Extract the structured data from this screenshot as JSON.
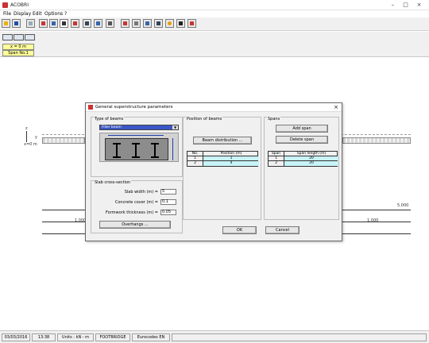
{
  "app": {
    "title": "ACOBRI"
  },
  "menu": [
    "File",
    "Display",
    "Edit",
    "Options",
    "?"
  ],
  "toolbar": {
    "icons": [
      "open-icon",
      "save-icon",
      "document-icon",
      "beam-icon",
      "deck-icon",
      "section-icon",
      "girder-icon",
      "i-beam-icon",
      "stiffener-icon",
      "support-icon",
      "load-icon",
      "y-icon",
      "color-wheel-icon",
      "calc-icon",
      "moment-icon"
    ]
  },
  "secondary": {
    "position_label": "x = 0 m",
    "span_label": "Span No.1"
  },
  "canvas": {
    "origin_label": "x=0 m",
    "z_label": "z",
    "y_label": "y",
    "dim_left": "1.000",
    "dim_right": "1.000",
    "dim_top": "5.000"
  },
  "status": {
    "date": "03/03/2016",
    "time": "13:38",
    "units": "Units : kN - m",
    "mode": "FOOTBRIDGE",
    "code": "Eurocodes EN"
  },
  "dialog": {
    "title": "General superstructure parameters",
    "beams_group": "Type of beams",
    "beam_type": "Filler beam",
    "slab_group": "Slab cross-section",
    "slab_width_label": "Slab width (m) =",
    "slab_width": "5",
    "cover_label": "Concrete cover (m) =",
    "cover": "0.1",
    "formwork_label": "Formwork thickness (m) =",
    "formwork": "0.05",
    "overhangs_btn": "Overhangs ...",
    "position_group": "Position of beams",
    "distribution_btn": "Beam distribution ...",
    "pos_headers": [
      "No.",
      "Position (m)"
    ],
    "pos_rows": [
      [
        "1",
        "1"
      ],
      [
        "2",
        "4"
      ]
    ],
    "spans_group": "Spans",
    "add_span_btn": "Add span",
    "delete_span_btn": "Delete span",
    "span_headers": [
      "Span",
      "Span length (m)"
    ],
    "span_rows": [
      [
        "1",
        "20"
      ],
      [
        "2",
        "20"
      ]
    ],
    "ok_btn": "OK",
    "cancel_btn": "Cancel"
  }
}
